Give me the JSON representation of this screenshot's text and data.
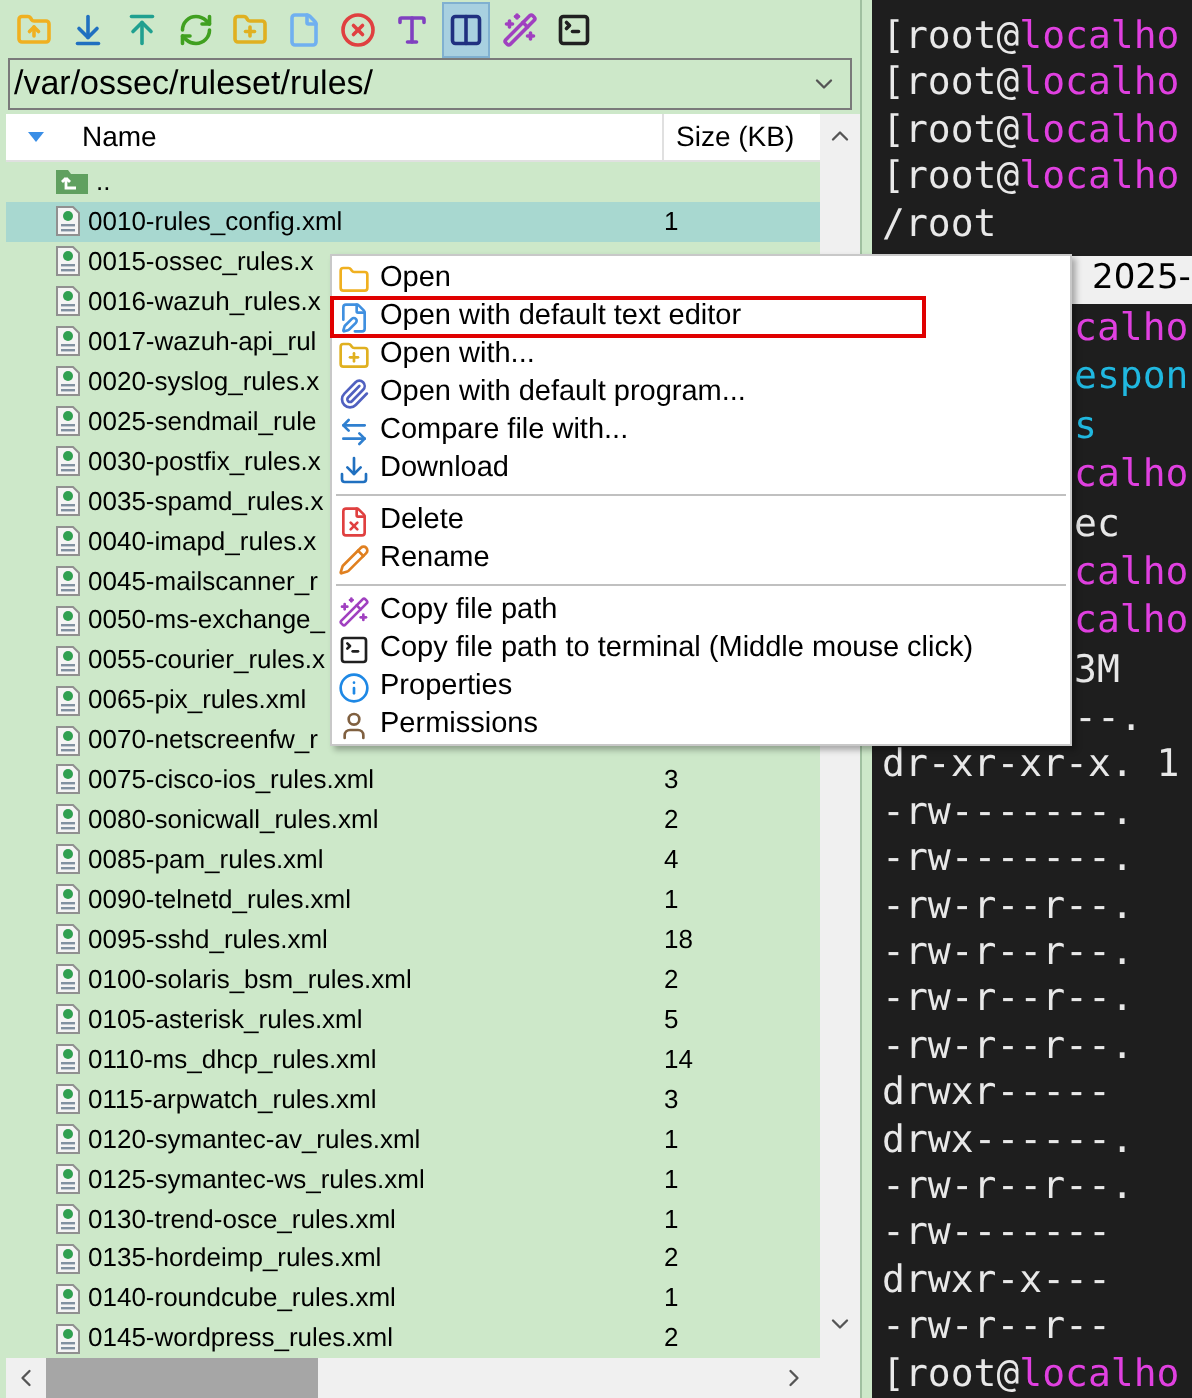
{
  "toolbar": [
    {
      "kind": "parent",
      "selected": false
    },
    {
      "kind": "download",
      "selected": false
    },
    {
      "kind": "upload",
      "selected": false
    },
    {
      "kind": "refresh",
      "selected": false
    },
    {
      "kind": "new-folder",
      "selected": false
    },
    {
      "kind": "new-file",
      "selected": false
    },
    {
      "kind": "delete",
      "selected": false
    },
    {
      "kind": "rename",
      "selected": false
    },
    {
      "kind": "split",
      "selected": true
    },
    {
      "kind": "wand",
      "selected": false
    },
    {
      "kind": "terminal",
      "selected": false
    }
  ],
  "path": {
    "value": "/var/ossec/ruleset/rules/"
  },
  "columns": [
    "Name",
    "Size (KB)"
  ],
  "rows": [
    {
      "kind": "parent",
      "name": "..",
      "selected": false
    },
    {
      "kind": "file",
      "name": "0010-rules_config.xml",
      "size": "1",
      "selected": true
    },
    {
      "kind": "file",
      "name": "0015-ossec_rules.x",
      "selected": false
    },
    {
      "kind": "file",
      "name": "0016-wazuh_rules.x",
      "selected": false
    },
    {
      "kind": "file",
      "name": "0017-wazuh-api_rul",
      "selected": false
    },
    {
      "kind": "file",
      "name": "0020-syslog_rules.x",
      "selected": false
    },
    {
      "kind": "file",
      "name": "0025-sendmail_rule",
      "selected": false
    },
    {
      "kind": "file",
      "name": "0030-postfix_rules.x",
      "selected": false
    },
    {
      "kind": "file",
      "name": "0035-spamd_rules.x",
      "selected": false
    },
    {
      "kind": "file",
      "name": "0040-imapd_rules.x",
      "selected": false
    },
    {
      "kind": "file",
      "name": "0045-mailscanner_r",
      "selected": false
    },
    {
      "kind": "file",
      "name": "0050-ms-exchange_",
      "selected": false
    },
    {
      "kind": "file",
      "name": "0055-courier_rules.x",
      "selected": false
    },
    {
      "kind": "file",
      "name": "0065-pix_rules.xml",
      "selected": false
    },
    {
      "kind": "file",
      "name": "0070-netscreenfw_r",
      "selected": false
    },
    {
      "kind": "file",
      "name": "0075-cisco-ios_rules.xml",
      "size": "3",
      "selected": false
    },
    {
      "kind": "file",
      "name": "0080-sonicwall_rules.xml",
      "size": "2",
      "selected": false
    },
    {
      "kind": "file",
      "name": "0085-pam_rules.xml",
      "size": "4",
      "selected": false
    },
    {
      "kind": "file",
      "name": "0090-telnetd_rules.xml",
      "size": "1",
      "selected": false
    },
    {
      "kind": "file",
      "name": "0095-sshd_rules.xml",
      "size": "18",
      "selected": false
    },
    {
      "kind": "file",
      "name": "0100-solaris_bsm_rules.xml",
      "size": "2",
      "selected": false
    },
    {
      "kind": "file",
      "name": "0105-asterisk_rules.xml",
      "size": "5",
      "selected": false
    },
    {
      "kind": "file",
      "name": "0110-ms_dhcp_rules.xml",
      "size": "14",
      "selected": false
    },
    {
      "kind": "file",
      "name": "0115-arpwatch_rules.xml",
      "size": "3",
      "selected": false
    },
    {
      "kind": "file",
      "name": "0120-symantec-av_rules.xml",
      "size": "1",
      "selected": false
    },
    {
      "kind": "file",
      "name": "0125-symantec-ws_rules.xml",
      "size": "1",
      "selected": false
    },
    {
      "kind": "file",
      "name": "0130-trend-osce_rules.xml",
      "size": "1",
      "selected": false
    },
    {
      "kind": "file",
      "name": "0135-hordeimp_rules.xml",
      "size": "2",
      "selected": false
    },
    {
      "kind": "file",
      "name": "0140-roundcube_rules.xml",
      "size": "1",
      "selected": false
    },
    {
      "kind": "file",
      "name": "0145-wordpress_rules.xml",
      "size": "2",
      "selected": false
    }
  ],
  "context_menu": [
    {
      "kind": "open",
      "label": "Open",
      "highlighted": false
    },
    {
      "kind": "text-editor",
      "label": "Open with default text editor",
      "highlighted": true
    },
    {
      "kind": "open-with",
      "label": "Open with...",
      "highlighted": false
    },
    {
      "kind": "default-program",
      "label": "Open with default program...",
      "highlighted": false
    },
    {
      "kind": "compare",
      "label": "Compare file with...",
      "highlighted": false
    },
    {
      "kind": "download",
      "label": "Download",
      "highlighted": false
    },
    {
      "kind": "separator"
    },
    {
      "kind": "delete",
      "label": "Delete",
      "highlighted": false
    },
    {
      "kind": "rename",
      "label": "Rename",
      "highlighted": false
    },
    {
      "kind": "separator"
    },
    {
      "kind": "copy-path",
      "label": "Copy file path",
      "highlighted": false
    },
    {
      "kind": "copy-terminal",
      "label": "Copy file path to terminal (Middle mouse click)",
      "highlighted": false
    },
    {
      "kind": "properties",
      "label": "Properties",
      "highlighted": false
    },
    {
      "kind": "permissions",
      "label": "Permissions",
      "highlighted": false
    }
  ],
  "terminal": {
    "lines_top": [
      [
        {
          "text": "[root@",
          "color": "#e8e8e8"
        },
        {
          "text": "localho",
          "color": "#e040e0"
        }
      ],
      [
        {
          "text": "[root@",
          "color": "#e8e8e8"
        },
        {
          "text": "localho",
          "color": "#e040e0"
        }
      ],
      [
        {
          "text": "[root@",
          "color": "#e8e8e8"
        },
        {
          "text": "localho",
          "color": "#e040e0"
        }
      ],
      [
        {
          "text": "[root@",
          "color": "#e8e8e8"
        },
        {
          "text": "localho",
          "color": "#e040e0"
        }
      ],
      [
        {
          "text": "/root",
          "color": "#e8e8e8"
        }
      ]
    ],
    "tab": "2025-",
    "lines_partial": [
      [
        {
          "text": "calho",
          "color": "#e040e0"
        }
      ],
      [
        {
          "text": "espon",
          "color": "#20b8e0"
        }
      ],
      [
        {
          "text": "s",
          "color": "#20b8e0"
        }
      ],
      [
        {
          "text": "calho",
          "color": "#e040e0"
        }
      ],
      [
        {
          "text": "ec",
          "color": "#e8e8e8"
        }
      ],
      [
        {
          "text": "calho",
          "color": "#e040e0"
        }
      ],
      [
        {
          "text": "calho",
          "color": "#e040e0"
        }
      ],
      [
        {
          "text": "3M",
          "color": "#e8e8e8"
        }
      ],
      [
        {
          "text": "--.",
          "color": "#e8e8e8"
        }
      ]
    ],
    "lines_bottom": [
      [
        {
          "text": "dr-xr-xr-x. 1",
          "color": "#e8e8e8"
        }
      ],
      [
        {
          "text": "-rw-------.",
          "color": "#e8e8e8"
        }
      ],
      [
        {
          "text": "-rw-------.",
          "color": "#e8e8e8"
        }
      ],
      [
        {
          "text": "-rw-r--r--.",
          "color": "#e8e8e8"
        }
      ],
      [
        {
          "text": "-rw-r--r--.",
          "color": "#e8e8e8"
        }
      ],
      [
        {
          "text": "-rw-r--r--.",
          "color": "#e8e8e8"
        }
      ],
      [
        {
          "text": "-rw-r--r--.",
          "color": "#e8e8e8"
        }
      ],
      [
        {
          "text": "drwxr-----",
          "color": "#e8e8e8"
        }
      ],
      [
        {
          "text": "drwx------.",
          "color": "#e8e8e8"
        }
      ],
      [
        {
          "text": "-rw-r--r--.",
          "color": "#e8e8e8"
        }
      ],
      [
        {
          "text": "-rw-------",
          "color": "#e8e8e8"
        }
      ],
      [
        {
          "text": "drwxr-x---",
          "color": "#e8e8e8"
        }
      ],
      [
        {
          "text": "-rw-r--r--",
          "color": "#e8e8e8"
        }
      ],
      [
        {
          "text": "[root@",
          "color": "#e8e8e8"
        },
        {
          "text": "localho",
          "color": "#e040e0"
        }
      ]
    ]
  }
}
